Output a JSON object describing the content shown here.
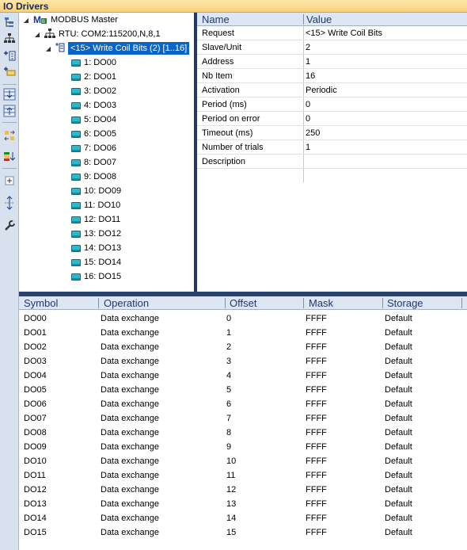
{
  "window": {
    "title": "IO Drivers"
  },
  "toolbar": {
    "icons": [
      "tree-view-icon",
      "network-icon",
      "add-request-icon",
      "add-item-icon",
      "move-down-icon",
      "move-up-icon",
      "swap-icon",
      "import-icon",
      "expand-icon",
      "vertical-resize-icon",
      "wrench-icon"
    ]
  },
  "tree": {
    "root": {
      "label": "MODBUS Master"
    },
    "rtu": {
      "label": "RTU: COM2:115200,N,8,1"
    },
    "request": {
      "label": "<15> Write Coil Bits (2) [1..16]"
    },
    "items": [
      {
        "label": "1: DO00"
      },
      {
        "label": "2: DO01"
      },
      {
        "label": "3: DO02"
      },
      {
        "label": "4: DO03"
      },
      {
        "label": "5: DO04"
      },
      {
        "label": "6: DO05"
      },
      {
        "label": "7: DO06"
      },
      {
        "label": "8: DO07"
      },
      {
        "label": "9: DO08"
      },
      {
        "label": "10: DO09"
      },
      {
        "label": "11: DO10"
      },
      {
        "label": "12: DO11"
      },
      {
        "label": "13: DO12"
      },
      {
        "label": "14: DO13"
      },
      {
        "label": "15: DO14"
      },
      {
        "label": "16: DO15"
      }
    ]
  },
  "properties": {
    "headers": {
      "name": "Name",
      "value": "Value"
    },
    "rows": [
      {
        "name": "Request",
        "value": "<15> Write Coil Bits"
      },
      {
        "name": "Slave/Unit",
        "value": "2"
      },
      {
        "name": "Address",
        "value": "1"
      },
      {
        "name": "Nb Item",
        "value": "16"
      },
      {
        "name": "Activation",
        "value": "Periodic"
      },
      {
        "name": "Period (ms)",
        "value": "0"
      },
      {
        "name": "Period on error",
        "value": "0"
      },
      {
        "name": "Timeout (ms)",
        "value": "250"
      },
      {
        "name": "Number of trials",
        "value": "1"
      },
      {
        "name": "Description",
        "value": ""
      }
    ]
  },
  "grid": {
    "headers": {
      "symbol": "Symbol",
      "operation": "Operation",
      "offset": "Offset",
      "mask": "Mask",
      "storage": "Storage"
    },
    "rows": [
      {
        "symbol": "DO00",
        "operation": "Data exchange",
        "offset": "0",
        "mask": "FFFF",
        "storage": "Default"
      },
      {
        "symbol": "DO01",
        "operation": "Data exchange",
        "offset": "1",
        "mask": "FFFF",
        "storage": "Default"
      },
      {
        "symbol": "DO02",
        "operation": "Data exchange",
        "offset": "2",
        "mask": "FFFF",
        "storage": "Default"
      },
      {
        "symbol": "DO03",
        "operation": "Data exchange",
        "offset": "3",
        "mask": "FFFF",
        "storage": "Default"
      },
      {
        "symbol": "DO04",
        "operation": "Data exchange",
        "offset": "4",
        "mask": "FFFF",
        "storage": "Default"
      },
      {
        "symbol": "DO05",
        "operation": "Data exchange",
        "offset": "5",
        "mask": "FFFF",
        "storage": "Default"
      },
      {
        "symbol": "DO06",
        "operation": "Data exchange",
        "offset": "6",
        "mask": "FFFF",
        "storage": "Default"
      },
      {
        "symbol": "DO07",
        "operation": "Data exchange",
        "offset": "7",
        "mask": "FFFF",
        "storage": "Default"
      },
      {
        "symbol": "DO08",
        "operation": "Data exchange",
        "offset": "8",
        "mask": "FFFF",
        "storage": "Default"
      },
      {
        "symbol": "DO09",
        "operation": "Data exchange",
        "offset": "9",
        "mask": "FFFF",
        "storage": "Default"
      },
      {
        "symbol": "DO10",
        "operation": "Data exchange",
        "offset": "10",
        "mask": "FFFF",
        "storage": "Default"
      },
      {
        "symbol": "DO11",
        "operation": "Data exchange",
        "offset": "11",
        "mask": "FFFF",
        "storage": "Default"
      },
      {
        "symbol": "DO12",
        "operation": "Data exchange",
        "offset": "12",
        "mask": "FFFF",
        "storage": "Default"
      },
      {
        "symbol": "DO13",
        "operation": "Data exchange",
        "offset": "13",
        "mask": "FFFF",
        "storage": "Default"
      },
      {
        "symbol": "DO14",
        "operation": "Data exchange",
        "offset": "14",
        "mask": "FFFF",
        "storage": "Default"
      },
      {
        "symbol": "DO15",
        "operation": "Data exchange",
        "offset": "15",
        "mask": "FFFF",
        "storage": "Default"
      }
    ]
  },
  "colors": {
    "selection": "#0a64c8",
    "title_bar": "#f6d27a",
    "splitter": "#1f3a66",
    "coil_icon": "#2fb9c9"
  }
}
